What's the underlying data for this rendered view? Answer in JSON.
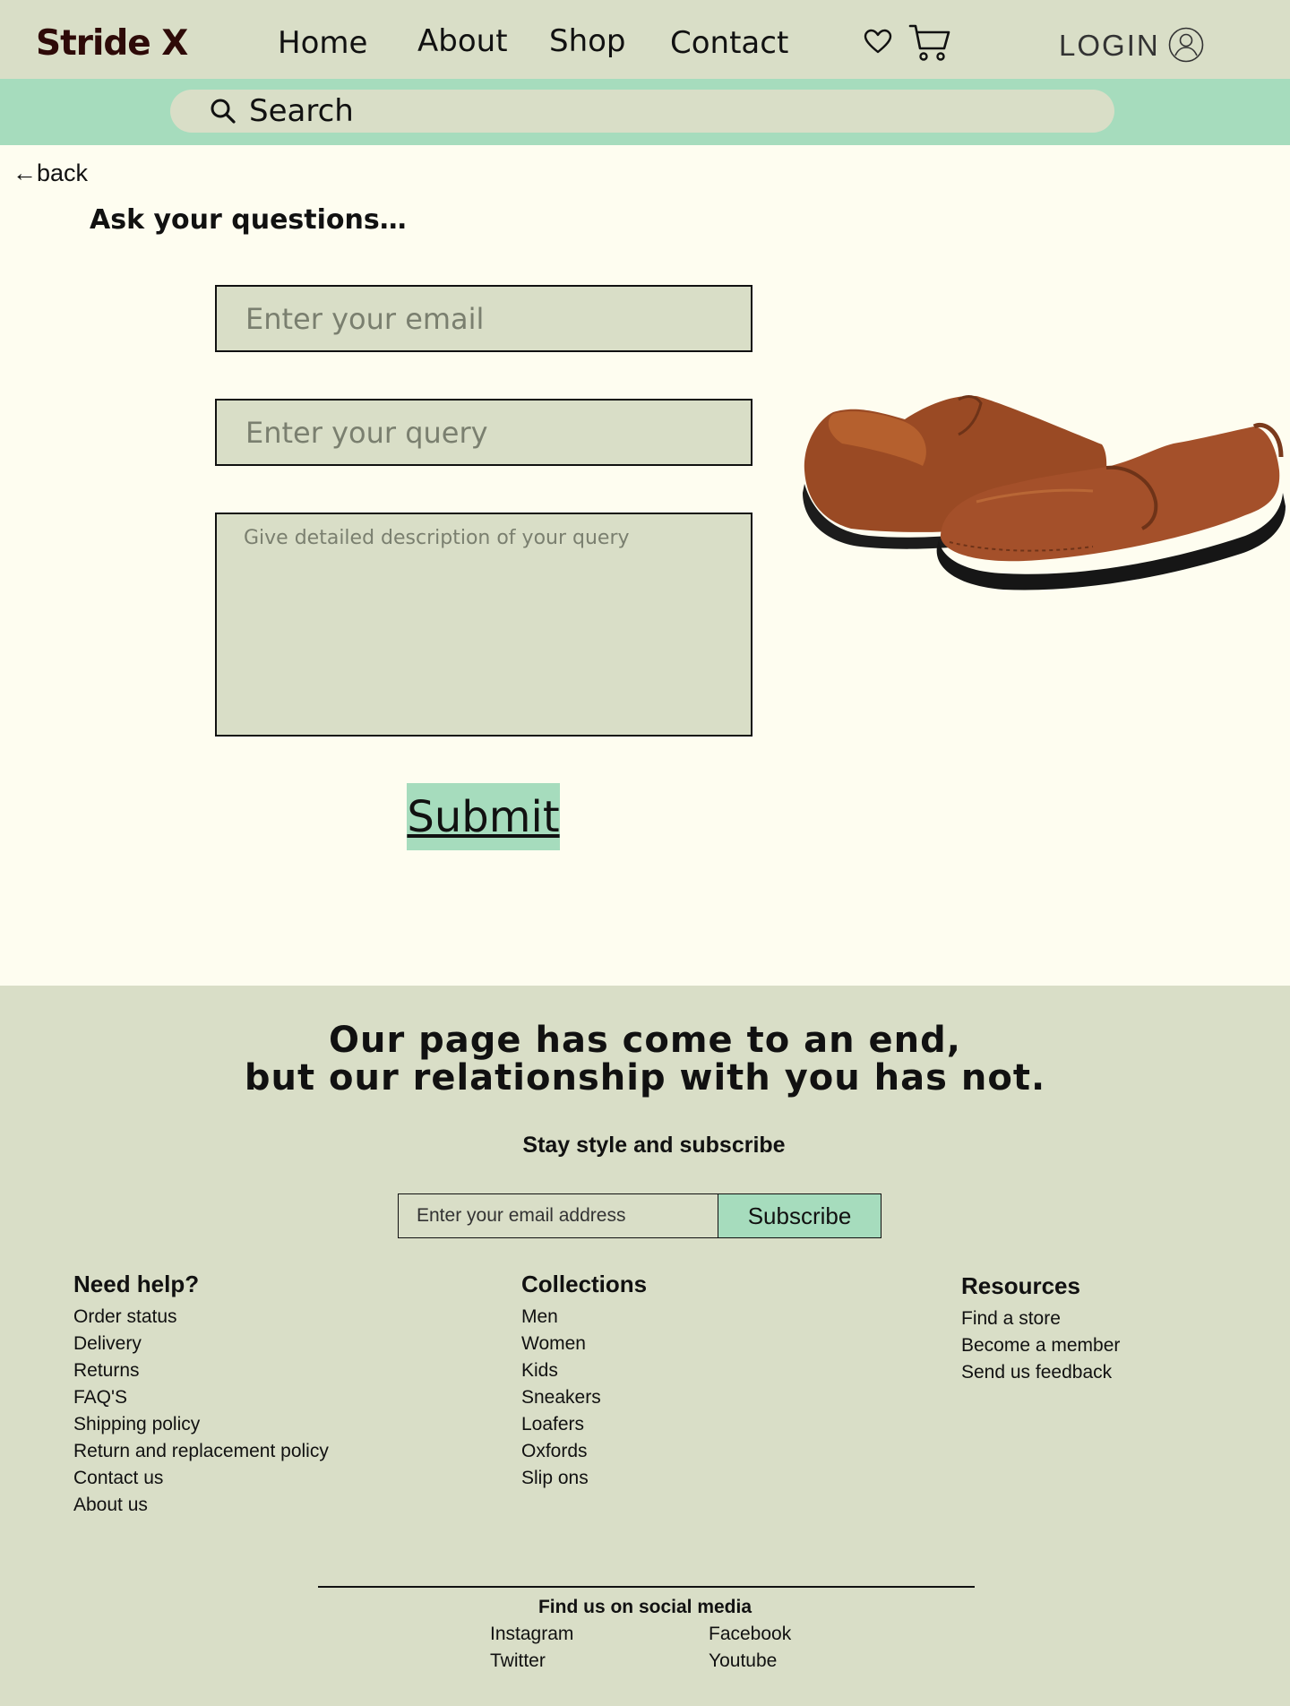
{
  "header": {
    "logo": "Stride X",
    "nav": [
      "Home",
      "About",
      "Shop",
      "Contact"
    ],
    "login": "LOGIN"
  },
  "search": {
    "label": "Search"
  },
  "main": {
    "back": "←back",
    "title": "Ask your questions…",
    "email_placeholder": "Enter your email",
    "query_placeholder": "Enter your query",
    "desc_placeholder": "Give detailed description of your query",
    "submit": "Submit"
  },
  "footer": {
    "heading_line1": "Our page has come to an end,",
    "heading_line2": "but our relationship with you has not.",
    "subscribe_heading": "Stay style and subscribe",
    "subscribe_placeholder": "Enter your email address",
    "subscribe_button": "Subscribe",
    "columns": [
      {
        "title": "Need help?",
        "links": [
          "Order status",
          "Delivery",
          "Returns",
          "FAQ'S",
          "Shipping policy",
          "Return and replacement policy",
          "Contact us",
          "About us"
        ]
      },
      {
        "title": "Collections",
        "links": [
          "Men",
          "Women",
          "Kids",
          "Sneakers",
          "Loafers",
          "Oxfords",
          "Slip ons"
        ]
      },
      {
        "title": "Resources",
        "links": [
          "Find a store",
          "Become a member",
          "Send us feedback"
        ]
      }
    ],
    "social_title": "Find us on social media",
    "social": [
      "Instagram",
      "Facebook",
      "Twitter",
      "Youtube"
    ]
  },
  "colors": {
    "header_bg": "#d9dec7",
    "accent": "#a6dcbd",
    "page_bg": "#fefdf0",
    "logo": "#2e0a08"
  },
  "icons": [
    "heart-icon",
    "cart-icon",
    "user-icon",
    "search-icon",
    "loafer-shoe-image"
  ]
}
